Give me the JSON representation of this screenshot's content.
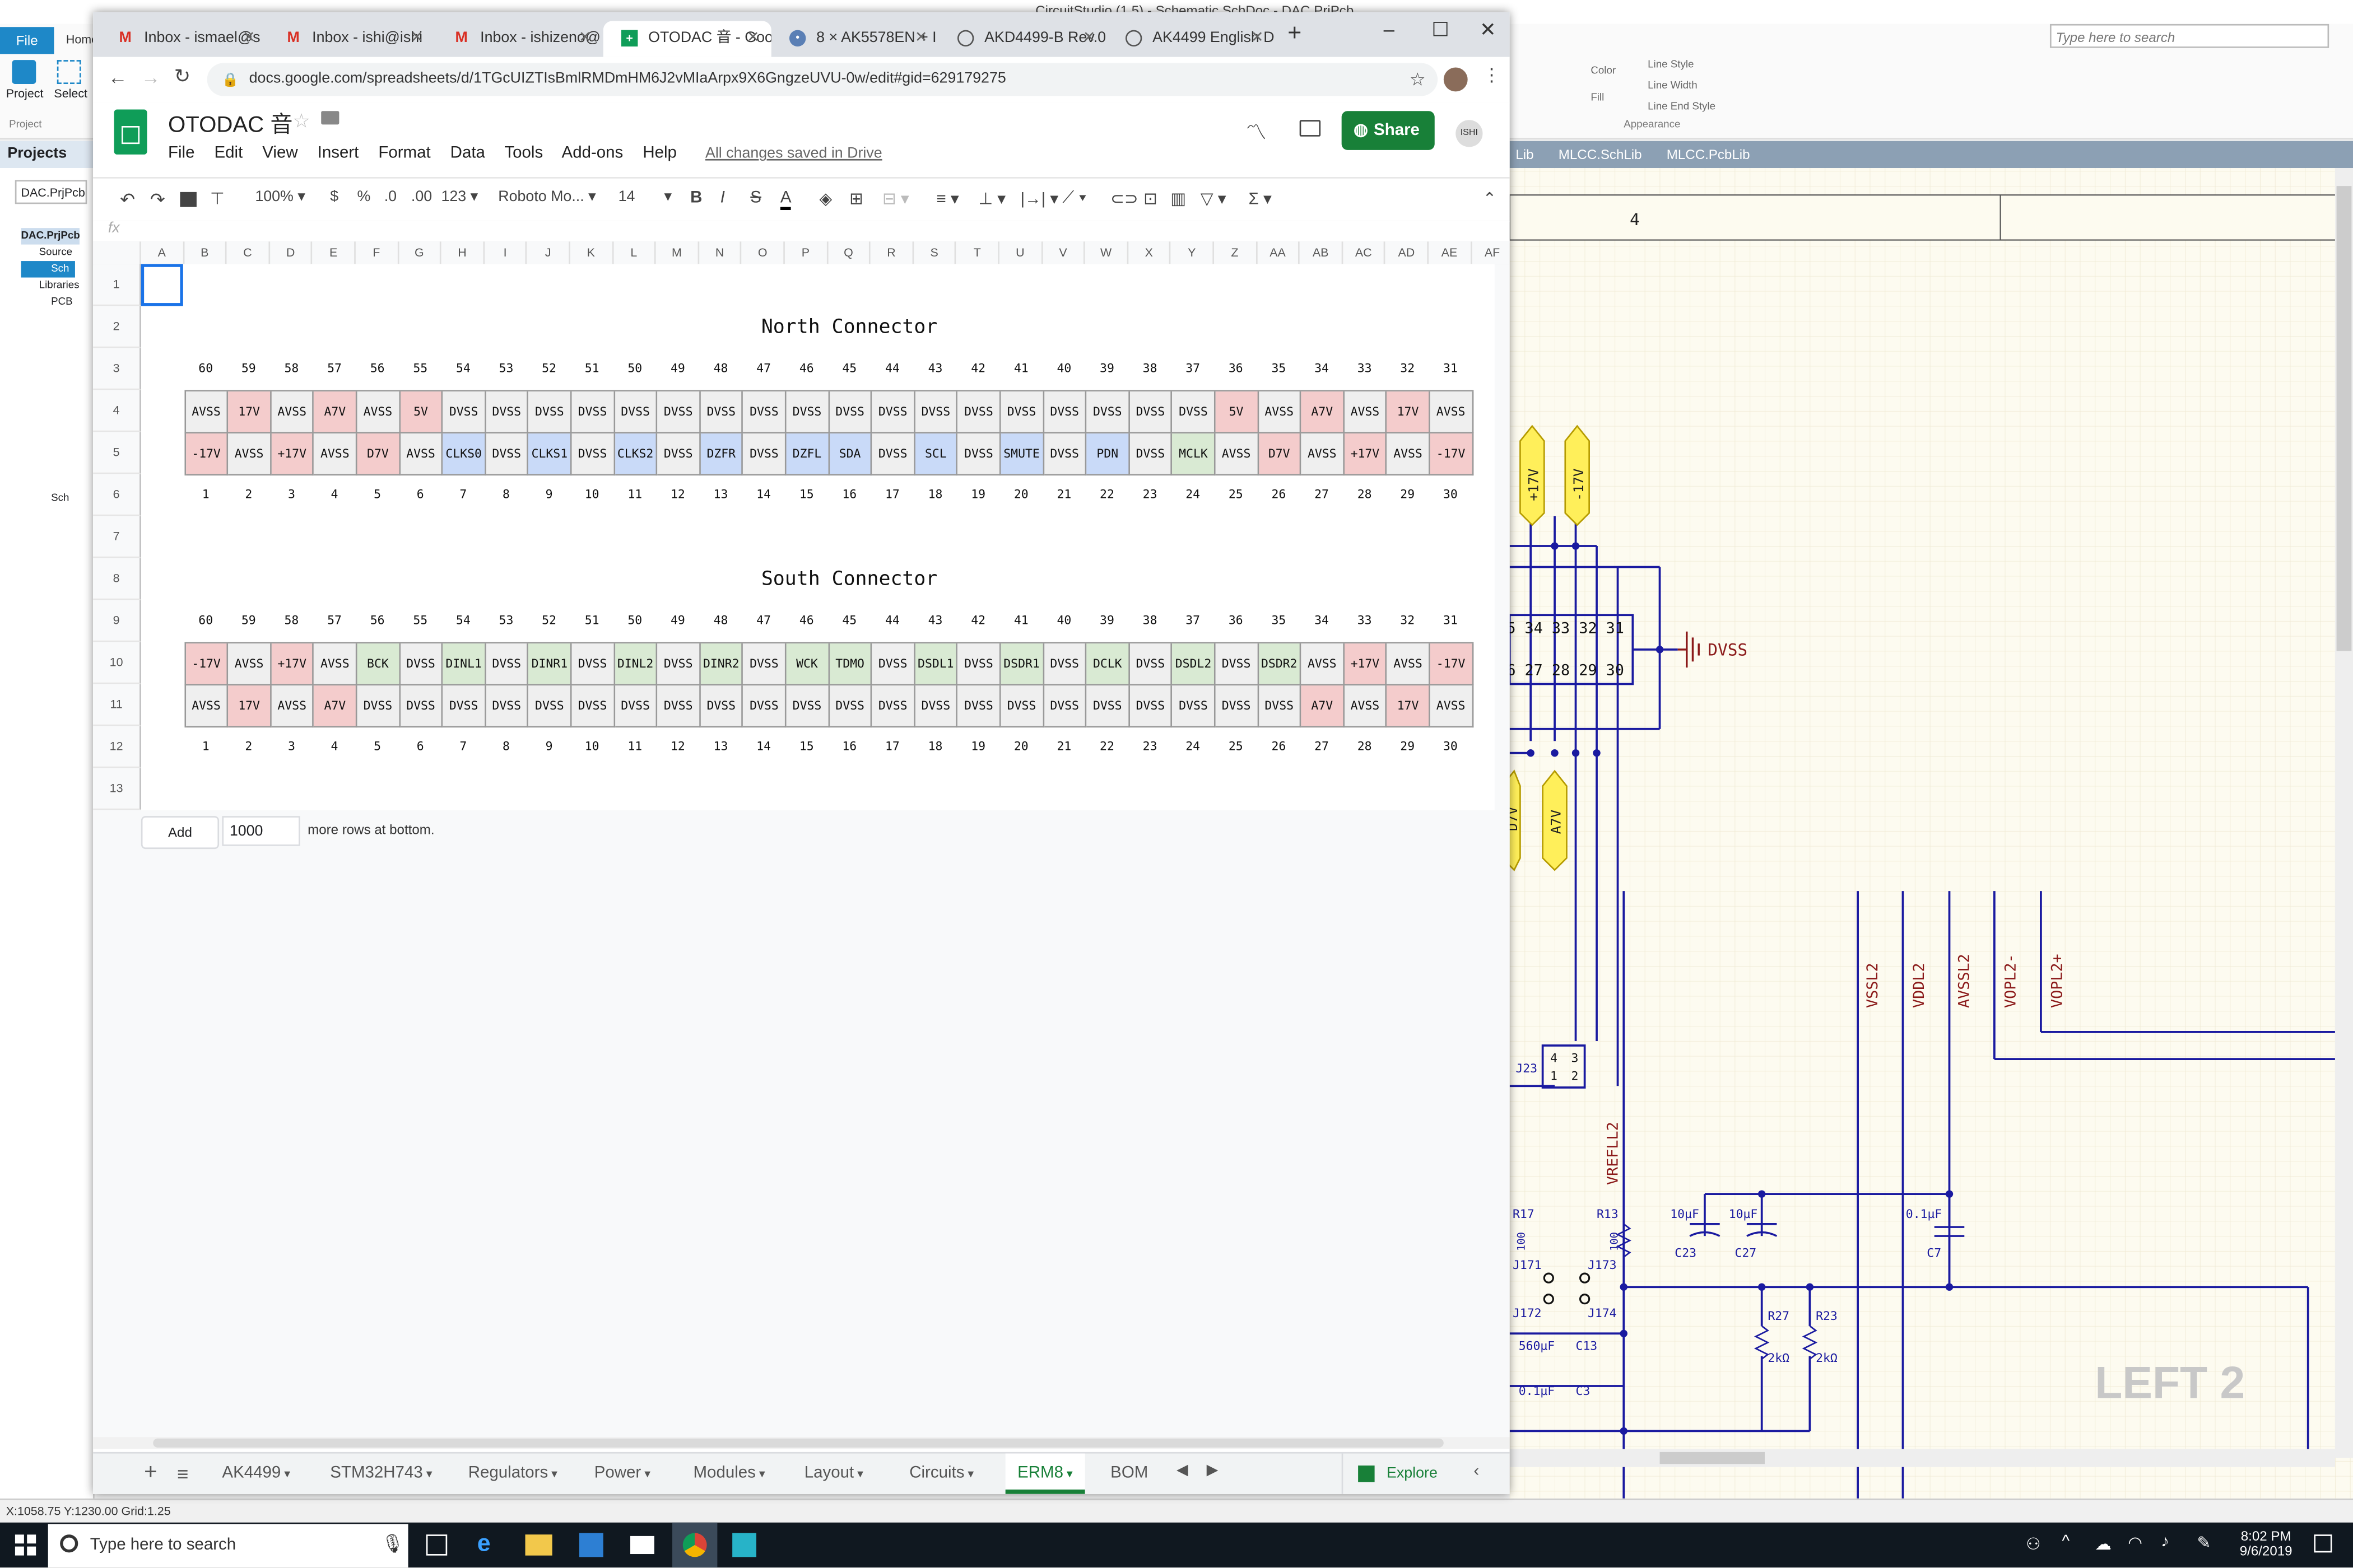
{
  "circuitstudio": {
    "title": "CircuitStudio (1.5) - Schematic SchDoc - DAC.PrjPcb",
    "file_tab": "File",
    "home_tab": "Home",
    "project_btn": "Project",
    "select_btn": "Select",
    "project_group": "Project",
    "search_placeholder": "Type here to search",
    "ribbon_color": "Color",
    "ribbon_fill": "Fill",
    "ribbon_line_style": "Line Style",
    "ribbon_line_width": "Line Width",
    "ribbon_line_end": "Line End Style",
    "ribbon_appearance": "Appearance",
    "projects_panel": "Projects",
    "project_name": "DAC.PrjPcb",
    "tree_root": "DAC.PrjPcb",
    "tree_source": "Source",
    "tree_sch": "Sch",
    "tree_libraries": "Libraries",
    "tree_pcb": "PCB",
    "tree_sch2": "Sch",
    "doc_tabs": [
      "Lib",
      "MLCC.SchLib",
      "MLCC.PcbLib"
    ],
    "status_text": "X:1058.75 Y:1230.00   Grid:1.25"
  },
  "schematic": {
    "zone_label": "4",
    "dvss": "DVSS",
    "pin_row_top": "5 34 33 32 31",
    "pin_row_bottom": "6 27 28 29 30",
    "plus17": "+17V",
    "minus17": "-17V",
    "a7v": "A7V",
    "d7v": "D7V",
    "net_labels": [
      "VSSL2",
      "VDDL2",
      "AVSSL2",
      "VOPL2-",
      "VOPL2+",
      "VREFLL2"
    ],
    "j23": "J23",
    "j23_pins": [
      "4",
      "3",
      "1",
      "2"
    ],
    "r17": "R17",
    "r13": "R13",
    "r100a": "100",
    "r100b": "100",
    "c23_val": "10µF",
    "c27_val": "10µF",
    "c7_val": "0.1µF",
    "c23": "C23",
    "c27": "C27",
    "c7": "C7",
    "j171": "J171",
    "j172": "J172",
    "j173": "J173",
    "j174": "J174",
    "r27": "R27",
    "r23": "R23",
    "r27_val": "2kΩ",
    "r23_val": "2kΩ",
    "c13_val": "560µF",
    "c13": "C13",
    "c3_val": "0.1µF",
    "c3": "C3",
    "sheet_label": "LEFT  2"
  },
  "taskbar": {
    "search_placeholder": "Type here to search",
    "time": "8:02 PM",
    "date": "9/6/2019"
  },
  "chrome": {
    "tabs": [
      {
        "label": "Inbox - ismael@s",
        "icon": "gmail-icon"
      },
      {
        "label": "Inbox - ishi@ishi",
        "icon": "gmail-icon"
      },
      {
        "label": "Inbox - ishizeno@",
        "icon": "gmail-icon"
      },
      {
        "label": "OTODAC 音 - Goo",
        "icon": "sheets-icon"
      },
      {
        "label": "8 × AK5578EN + I",
        "icon": "site-icon"
      },
      {
        "label": "AKD4499-B Rev.0",
        "icon": "globe-icon"
      },
      {
        "label": "AK4499 English D",
        "icon": "globe-icon"
      }
    ],
    "url": "docs.google.com/spreadsheets/d/1TGcUIZTIsBmlRMDmHM6J2vMIaArpx9X6GngzeUVU-0w/edit#gid=629179275"
  },
  "sheets": {
    "doc_title": "OTODAC 音",
    "menu": [
      "File",
      "Edit",
      "View",
      "Insert",
      "Format",
      "Data",
      "Tools",
      "Add-ons",
      "Help"
    ],
    "saved_status": "All changes saved in Drive",
    "share": "Share",
    "avatar_text": "ISHI",
    "toolbar": {
      "zoom": "100%",
      "currency": "$",
      "percent": "%",
      "dec_less": ".0",
      "dec_more": ".00",
      "format": "123",
      "font": "Roboto Mo...",
      "font_size": "14",
      "bold": "B",
      "italic": "I",
      "strike": "S",
      "textcolor": "A",
      "sum": "Σ"
    },
    "fx": "fx",
    "columns": [
      "A",
      "B",
      "C",
      "D",
      "E",
      "F",
      "G",
      "H",
      "I",
      "J",
      "K",
      "L",
      "M",
      "N",
      "O",
      "P",
      "Q",
      "R",
      "S",
      "T",
      "U",
      "V",
      "W",
      "X",
      "Y",
      "Z",
      "AA",
      "AB",
      "AC",
      "AD",
      "AE",
      "AF"
    ],
    "rows": [
      "1",
      "2",
      "3",
      "4",
      "5",
      "6",
      "7",
      "8",
      "9",
      "10",
      "11",
      "12",
      "13"
    ],
    "add_button": "Add",
    "add_value": "1000",
    "add_text": "more rows at bottom.",
    "sheet_tabs": [
      "AK4499",
      "STM32H743",
      "Regulators",
      "Power",
      "Modules",
      "Layout",
      "Circuits",
      "ERM8",
      "BOM"
    ],
    "active_tab": "ERM8",
    "explore": "Explore",
    "north": {
      "title": "North Connector",
      "top_pins": [
        "60",
        "59",
        "58",
        "57",
        "56",
        "55",
        "54",
        "53",
        "52",
        "51",
        "50",
        "49",
        "48",
        "47",
        "46",
        "45",
        "44",
        "43",
        "42",
        "41",
        "40",
        "39",
        "38",
        "37",
        "36",
        "35",
        "34",
        "33",
        "32",
        "31"
      ],
      "row_top": [
        "AVSS",
        "17V",
        "AVSS",
        "A7V",
        "AVSS",
        "5V",
        "DVSS",
        "DVSS",
        "DVSS",
        "DVSS",
        "DVSS",
        "DVSS",
        "DVSS",
        "DVSS",
        "DVSS",
        "DVSS",
        "DVSS",
        "DVSS",
        "DVSS",
        "DVSS",
        "DVSS",
        "DVSS",
        "DVSS",
        "DVSS",
        "5V",
        "AVSS",
        "A7V",
        "AVSS",
        "17V",
        "AVSS"
      ],
      "row_top_colors": [
        "grey",
        "red",
        "grey",
        "red",
        "grey",
        "red",
        "grey",
        "grey",
        "grey",
        "grey",
        "grey",
        "grey",
        "grey",
        "grey",
        "grey",
        "grey",
        "grey",
        "grey",
        "grey",
        "grey",
        "grey",
        "grey",
        "grey",
        "grey",
        "red",
        "grey",
        "red",
        "grey",
        "red",
        "grey"
      ],
      "row_bottom": [
        "-17V",
        "AVSS",
        "+17V",
        "AVSS",
        "D7V",
        "AVSS",
        "CLKS0",
        "DVSS",
        "CLKS1",
        "DVSS",
        "CLKS2",
        "DVSS",
        "DZFR",
        "DVSS",
        "DZFL",
        "SDA",
        "DVSS",
        "SCL",
        "DVSS",
        "SMUTE",
        "DVSS",
        "PDN",
        "DVSS",
        "MCLK",
        "AVSS",
        "D7V",
        "AVSS",
        "+17V",
        "AVSS",
        "-17V"
      ],
      "row_bottom_colors": [
        "red",
        "grey",
        "red",
        "grey",
        "red",
        "grey",
        "blue",
        "grey",
        "blue",
        "grey",
        "blue",
        "grey",
        "blue",
        "grey",
        "blue",
        "blue",
        "grey",
        "blue",
        "grey",
        "blue",
        "grey",
        "blue",
        "grey",
        "green",
        "grey",
        "red",
        "grey",
        "red",
        "grey",
        "red"
      ],
      "bottom_pins": [
        "1",
        "2",
        "3",
        "4",
        "5",
        "6",
        "7",
        "8",
        "9",
        "10",
        "11",
        "12",
        "13",
        "14",
        "15",
        "16",
        "17",
        "18",
        "19",
        "20",
        "21",
        "22",
        "23",
        "24",
        "25",
        "26",
        "27",
        "28",
        "29",
        "30"
      ]
    },
    "south": {
      "title": "South Connector",
      "top_pins": [
        "60",
        "59",
        "58",
        "57",
        "56",
        "55",
        "54",
        "53",
        "52",
        "51",
        "50",
        "49",
        "48",
        "47",
        "46",
        "45",
        "44",
        "43",
        "42",
        "41",
        "40",
        "39",
        "38",
        "37",
        "36",
        "35",
        "34",
        "33",
        "32",
        "31"
      ],
      "row_top": [
        "-17V",
        "AVSS",
        "+17V",
        "AVSS",
        "BCK",
        "DVSS",
        "DINL1",
        "DVSS",
        "DINR1",
        "DVSS",
        "DINL2",
        "DVSS",
        "DINR2",
        "DVSS",
        "WCK",
        "TDMO",
        "DVSS",
        "DSDL1",
        "DVSS",
        "DSDR1",
        "DVSS",
        "DCLK",
        "DVSS",
        "DSDL2",
        "DVSS",
        "DSDR2",
        "AVSS",
        "+17V",
        "AVSS",
        "-17V"
      ],
      "row_top_colors": [
        "red",
        "grey",
        "red",
        "grey",
        "green",
        "grey",
        "green",
        "grey",
        "green",
        "grey",
        "green",
        "grey",
        "green",
        "grey",
        "green",
        "green",
        "grey",
        "green",
        "grey",
        "green",
        "grey",
        "green",
        "grey",
        "green",
        "grey",
        "green",
        "grey",
        "red",
        "grey",
        "red"
      ],
      "row_bottom": [
        "AVSS",
        "17V",
        "AVSS",
        "A7V",
        "DVSS",
        "DVSS",
        "DVSS",
        "DVSS",
        "DVSS",
        "DVSS",
        "DVSS",
        "DVSS",
        "DVSS",
        "DVSS",
        "DVSS",
        "DVSS",
        "DVSS",
        "DVSS",
        "DVSS",
        "DVSS",
        "DVSS",
        "DVSS",
        "DVSS",
        "DVSS",
        "DVSS",
        "DVSS",
        "A7V",
        "AVSS",
        "17V",
        "AVSS"
      ],
      "row_bottom_colors": [
        "grey",
        "red",
        "grey",
        "red",
        "grey",
        "grey",
        "grey",
        "grey",
        "grey",
        "grey",
        "grey",
        "grey",
        "grey",
        "grey",
        "grey",
        "grey",
        "grey",
        "grey",
        "grey",
        "grey",
        "grey",
        "grey",
        "grey",
        "grey",
        "grey",
        "grey",
        "red",
        "grey",
        "red",
        "grey"
      ],
      "bottom_pins": [
        "1",
        "2",
        "3",
        "4",
        "5",
        "6",
        "7",
        "8",
        "9",
        "10",
        "11",
        "12",
        "13",
        "14",
        "15",
        "16",
        "17",
        "18",
        "19",
        "20",
        "21",
        "22",
        "23",
        "24",
        "25",
        "26",
        "27",
        "28",
        "29",
        "30"
      ]
    }
  },
  "colors": {
    "red": "#f4cccc",
    "blue": "#c9daf8",
    "green": "#d9ead3",
    "grey": "#efefef",
    "share": "#188038",
    "wire": "#1a1aa0",
    "net_red": "#8b1a1a"
  }
}
